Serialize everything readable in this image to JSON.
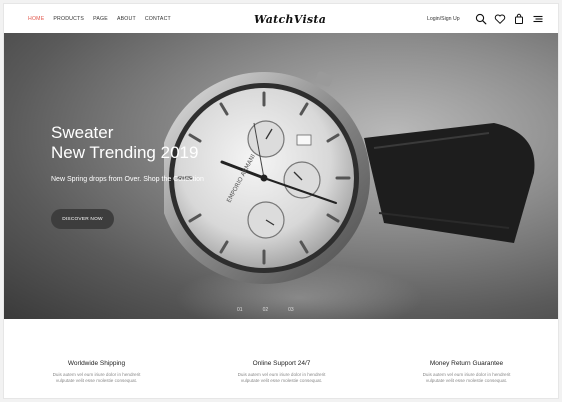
{
  "nav": {
    "items": [
      {
        "label": "HOME",
        "active": true
      },
      {
        "label": "PRODUCTS",
        "active": false
      },
      {
        "label": "PAGE",
        "active": false
      },
      {
        "label": "ABOUT",
        "active": false
      },
      {
        "label": "CONTACT",
        "active": false
      }
    ]
  },
  "brand": {
    "logo_text": "WatchVista"
  },
  "header": {
    "login_label": "Login/Sign Up",
    "icons": [
      "search-icon",
      "heart-icon",
      "bag-icon",
      "menu-icon"
    ]
  },
  "hero": {
    "title_line1": "Sweater",
    "title_line2": "New Trending 2019",
    "subtitle": "New Spring drops from Over. Shop the Collection",
    "cta_label": "DISCOVER NOW",
    "slider_dots": [
      "01",
      "02",
      "03"
    ],
    "watch_brand": "EMPORIO ARMANI"
  },
  "features": [
    {
      "title": "Worldwide Shipping",
      "description": "Duis autem vel eum iriure dolor in hendrerit vulputate velit esse molestie consequat."
    },
    {
      "title": "Online Support 24/7",
      "description": "Duis autem vel eum iriure dolor in hendrerit vulputate velit esse molestie consequat."
    },
    {
      "title": "Money Return Guarantee",
      "description": "Duis autem vel eum iriure dolor in hendrerit vulputate velit esse molestie consequat."
    }
  ],
  "colors": {
    "accent": "#e2574c",
    "button": "#3d3d3d"
  }
}
